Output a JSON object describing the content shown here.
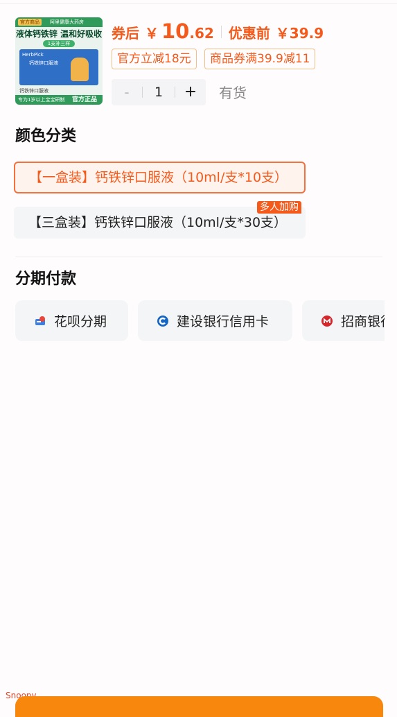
{
  "thumbnail": {
    "band_badge": "官方商品",
    "band_text": "阿里健康大药房",
    "headline": "液体钙铁锌 温和好吸收",
    "pill": "1支补三样",
    "box_brand": "HerbPick",
    "box_title": "钙铁锌口服液",
    "caption": "钙铁锌口服液",
    "foot_left": "专为1岁以上宝宝研制",
    "foot_right": "官方正品"
  },
  "price": {
    "after_label": "券后",
    "currency": "￥",
    "after_int": "10",
    "after_dec": ".62",
    "before_label": "优惠前",
    "before_value": "￥39.9"
  },
  "coupons": [
    "官方立减18元",
    "商品券满39.9减11"
  ],
  "quantity": {
    "minus": "-",
    "value": "1",
    "plus": "+",
    "stock": "有货"
  },
  "color_section": {
    "title": "颜色分类",
    "variants": [
      {
        "label": "【一盒装】钙铁锌口服液（10ml/支*10支）",
        "selected": true
      },
      {
        "label": "【三盒装】钙铁锌口服液（10ml/支*30支）",
        "selected": false,
        "tag": "多人加购"
      }
    ]
  },
  "installment_section": {
    "title": "分期付款",
    "options": [
      {
        "label": "花呗分期",
        "icon": "huabei-icon"
      },
      {
        "label": "建设银行信用卡",
        "icon": "ccb-icon"
      },
      {
        "label": "招商银行",
        "icon": "cmb-icon"
      }
    ]
  },
  "watermark": "Snoopy",
  "colors": {
    "accent": "#f35a1b",
    "bottom_bar": "#f7870d"
  }
}
